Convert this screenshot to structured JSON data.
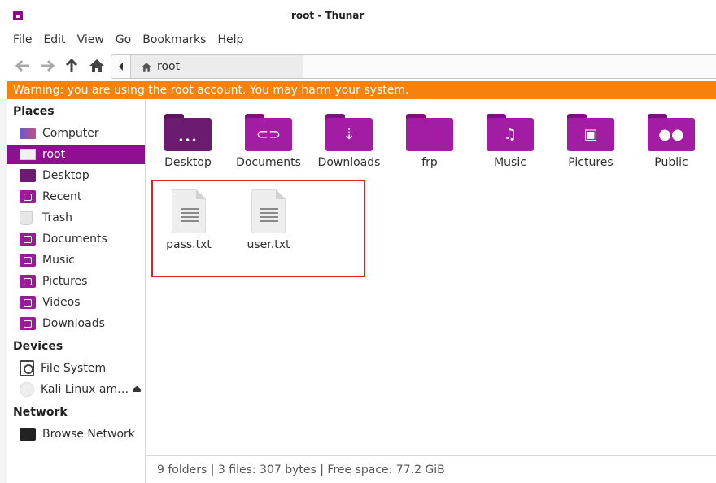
{
  "window": {
    "title": "root - Thunar"
  },
  "menu": [
    "File",
    "Edit",
    "View",
    "Go",
    "Bookmarks",
    "Help"
  ],
  "toolbar": {
    "icons": [
      "back-arrow-icon",
      "forward-arrow-icon",
      "up-arrow-icon",
      "home-icon"
    ],
    "path_crumb": "root"
  },
  "warning": "Warning: you are using the root account. You may harm your system.",
  "sidebar": {
    "places_header": "Places",
    "places": [
      {
        "label": "Computer",
        "icon": "computer-icon"
      },
      {
        "label": "root",
        "icon": "home-folder-icon",
        "active": true
      },
      {
        "label": "Desktop",
        "icon": "desktop-folder-icon"
      },
      {
        "label": "Recent",
        "icon": "recent-folder-icon"
      },
      {
        "label": "Trash",
        "icon": "trash-icon"
      },
      {
        "label": "Documents",
        "icon": "documents-folder-icon"
      },
      {
        "label": "Music",
        "icon": "music-folder-icon"
      },
      {
        "label": "Pictures",
        "icon": "pictures-folder-icon"
      },
      {
        "label": "Videos",
        "icon": "videos-folder-icon"
      },
      {
        "label": "Downloads",
        "icon": "downloads-folder-icon"
      }
    ],
    "devices_header": "Devices",
    "devices": [
      {
        "label": "File System",
        "icon": "drive-icon"
      },
      {
        "label": "Kali Linux am…",
        "icon": "optical-disc-icon"
      }
    ],
    "network_header": "Network",
    "network": [
      {
        "label": "Browse Network",
        "icon": "network-icon"
      }
    ]
  },
  "files": {
    "folders": [
      {
        "name": "Desktop",
        "icon": "desktop-folder-icon"
      },
      {
        "name": "Documents",
        "icon": "documents-folder-icon"
      },
      {
        "name": "Downloads",
        "icon": "downloads-folder-icon"
      },
      {
        "name": "frp",
        "icon": "folder-icon"
      },
      {
        "name": "Music",
        "icon": "music-folder-icon"
      },
      {
        "name": "Pictures",
        "icon": "pictures-folder-icon"
      },
      {
        "name": "Public",
        "icon": "public-folder-icon"
      }
    ],
    "documents": [
      {
        "name": "pass.txt",
        "icon": "text-file-icon"
      },
      {
        "name": "user.txt",
        "icon": "text-file-icon"
      }
    ]
  },
  "status": "9 folders  |  3 files: 307 bytes  |  Free space: 77.2 GiB",
  "colors": {
    "accent": "#8f0f91",
    "warning": "#f5820d",
    "highlight_box": "#e02020"
  }
}
